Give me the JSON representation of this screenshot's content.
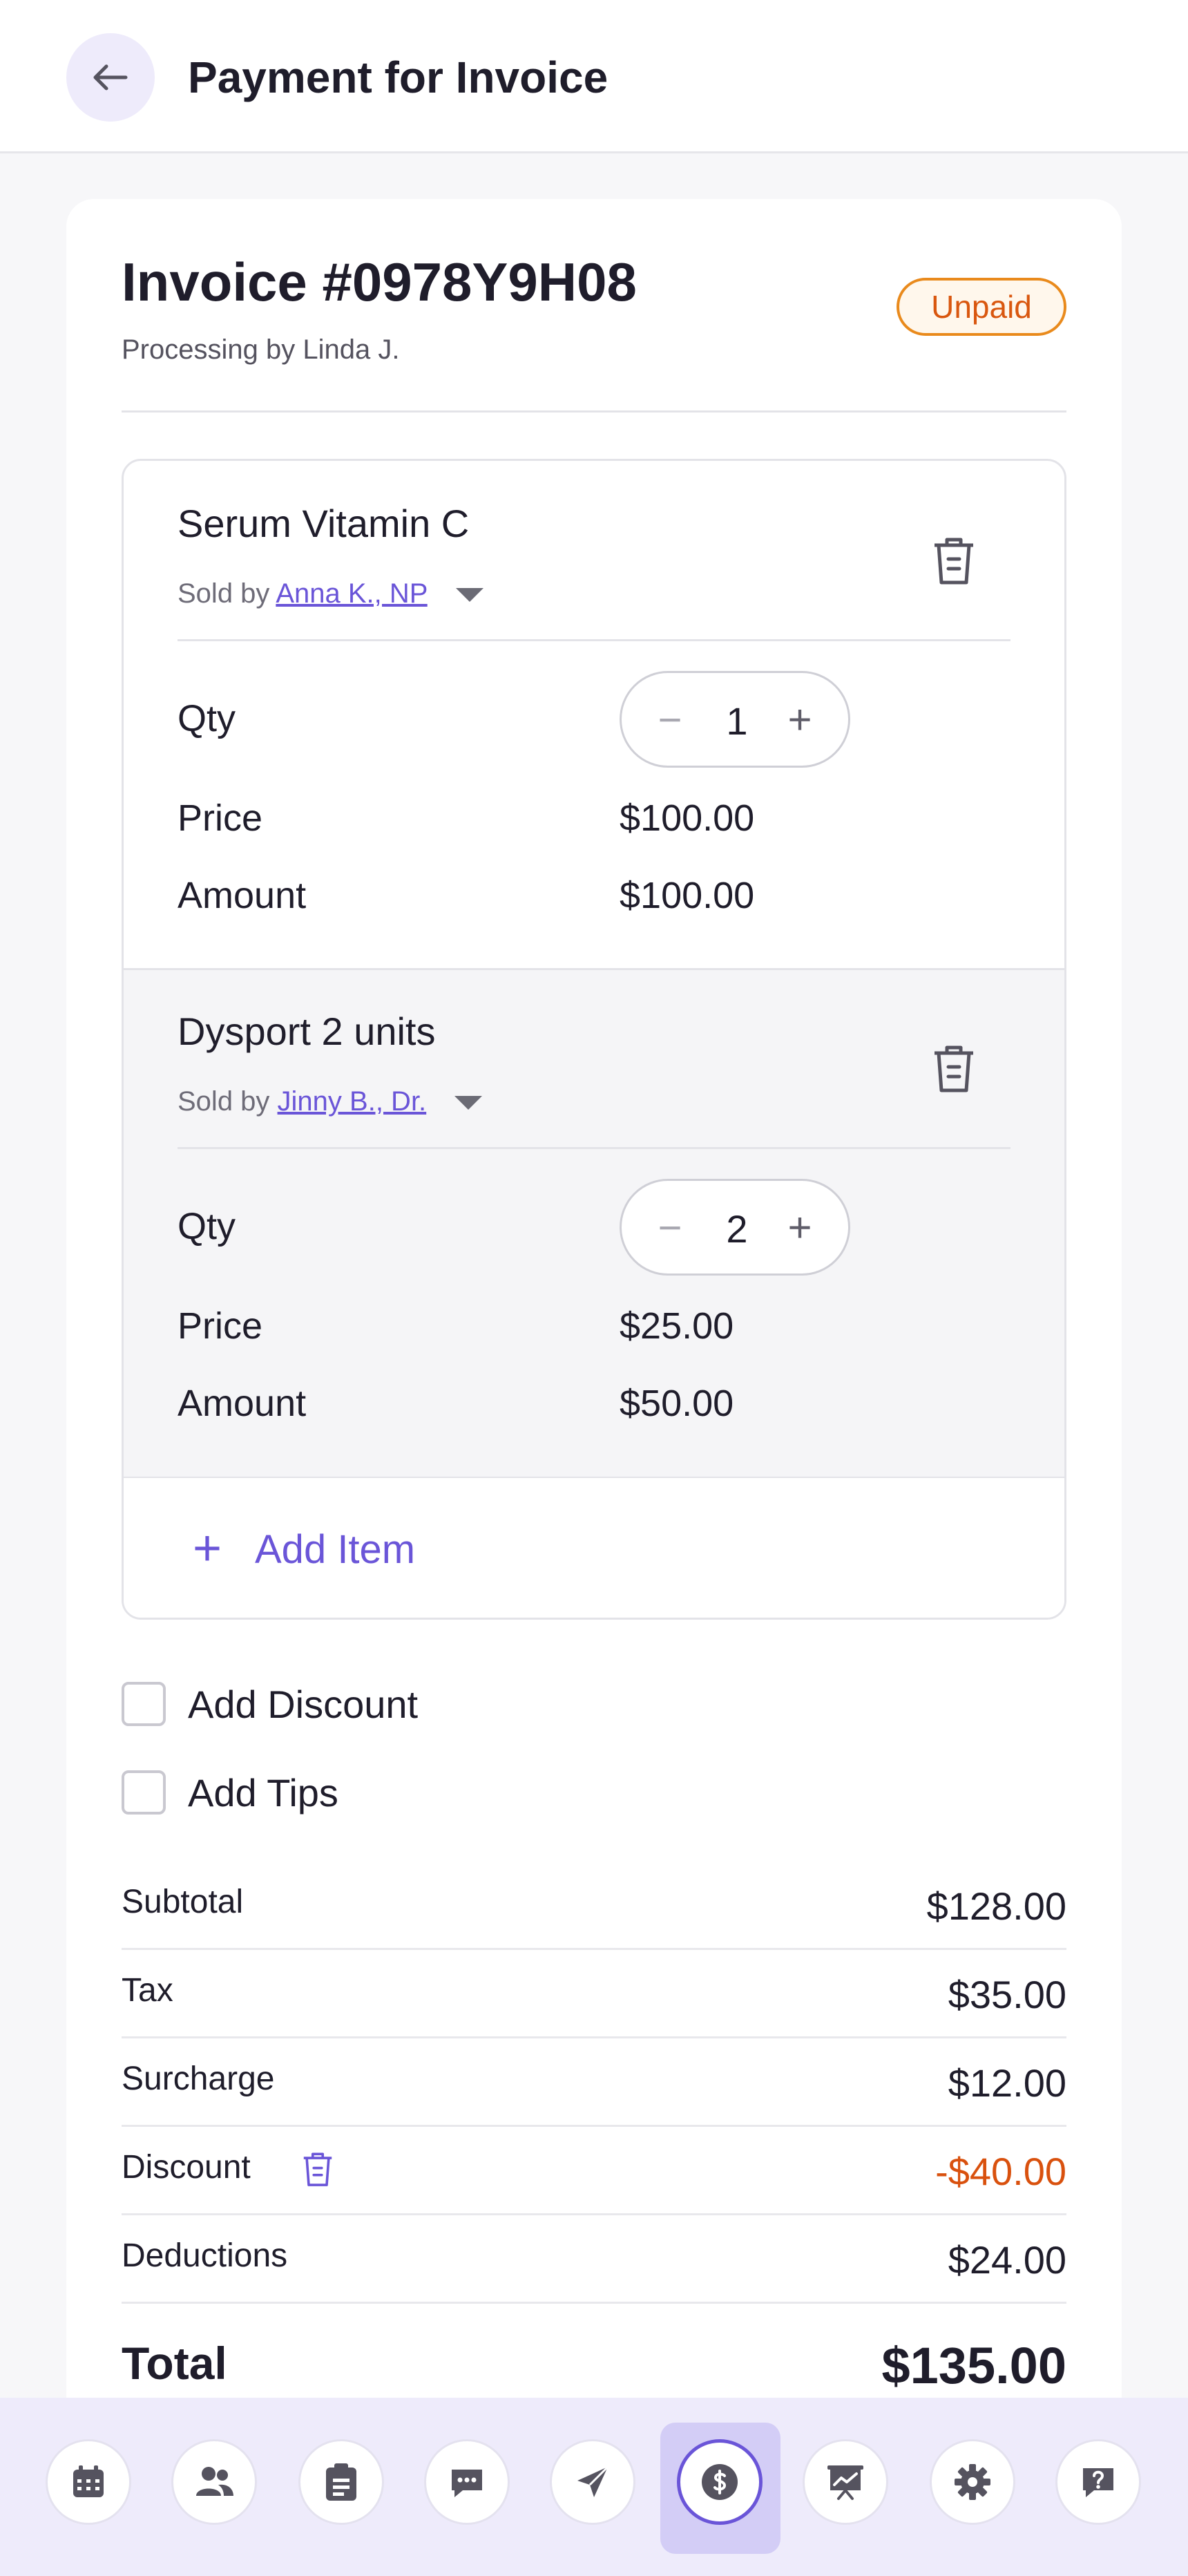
{
  "header": {
    "title": "Payment for Invoice"
  },
  "invoice": {
    "title": "Invoice #0978Y9H08",
    "processing": "Processing by Linda J.",
    "status": "Unpaid"
  },
  "items": [
    {
      "name": "Serum Vitamin C",
      "sold_by_prefix": "Sold by",
      "seller": "Anna K., NP",
      "qty_label": "Qty",
      "qty": "1",
      "price_label": "Price",
      "price": "$100.00",
      "amount_label": "Amount",
      "amount": "$100.00"
    },
    {
      "name": "Dysport 2 units",
      "sold_by_prefix": "Sold by",
      "seller": "Jinny B., Dr.",
      "qty_label": "Qty",
      "qty": "2",
      "price_label": "Price",
      "price": "$25.00",
      "amount_label": "Amount",
      "amount": "$50.00"
    }
  ],
  "add_item": {
    "icon": "+",
    "label": "Add Item"
  },
  "options": {
    "discount_label": "Add Discount",
    "tips_label": "Add Tips"
  },
  "summary": {
    "subtotal_label": "Subtotal",
    "subtotal": "$128.00",
    "tax_label": "Tax",
    "tax": "$35.00",
    "surcharge_label": "Surcharge",
    "surcharge": "$12.00",
    "discount_label": "Discount",
    "discount": "-$40.00",
    "deductions_label": "Deductions",
    "deductions": "$24.00",
    "total_label": "Total",
    "total": "$135.00"
  },
  "nav": [
    "calendar-icon",
    "clients-icon",
    "clipboard-icon",
    "chat-icon",
    "send-icon",
    "payments-icon",
    "reports-icon",
    "settings-icon",
    "help-icon"
  ],
  "colors": {
    "accent": "#6a55d8",
    "unpaid": "#d9570f",
    "discount": "#d9510e"
  }
}
